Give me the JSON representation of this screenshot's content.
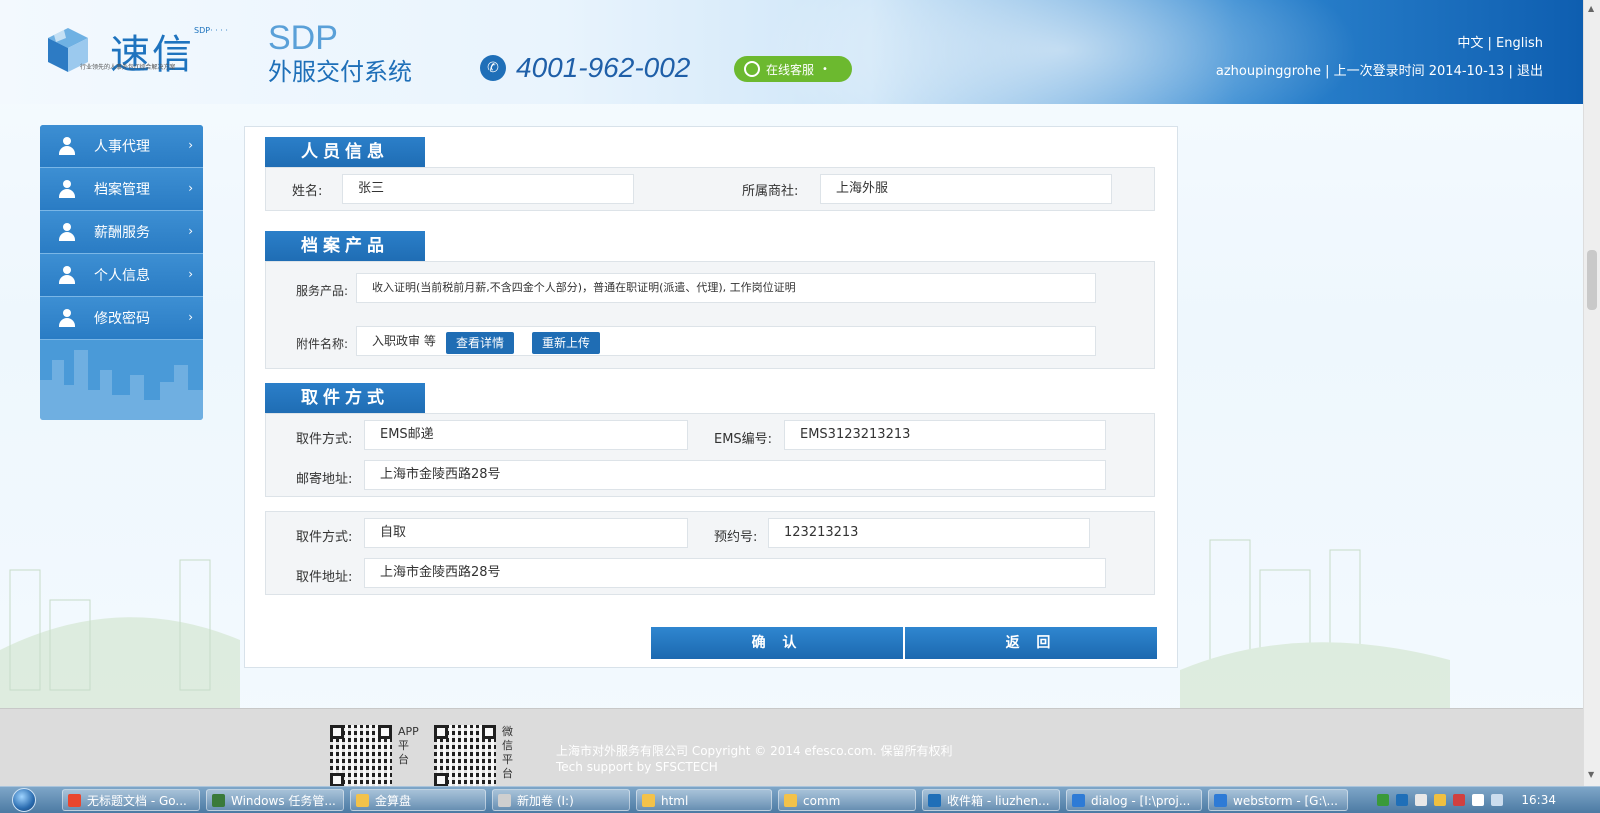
{
  "header": {
    "brand_cn": "速信",
    "brand_sdp": "SDP· · · ·",
    "brand_sub": "行业领先的人事外包IT综合解决方案",
    "brand_cube_text": "速立方",
    "sys_sdp": "SDP",
    "sys_name": "外服交付系统",
    "phone": "4001-962-002",
    "online_service": "在线客服",
    "lang_cn": "中文",
    "lang_sep": " | ",
    "lang_en": "English",
    "username": "azhoupinggrohe",
    "last_login_label": "上一次登录时间",
    "last_login_date": "2014-10-13",
    "logout": "退出"
  },
  "sidebar": {
    "items": [
      {
        "label": "人事代理"
      },
      {
        "label": "档案管理"
      },
      {
        "label": "薪酬服务"
      },
      {
        "label": "个人信息"
      },
      {
        "label": "修改密码"
      }
    ]
  },
  "person": {
    "title": "人员信息",
    "name_label": "姓名:",
    "name_value": "张三",
    "company_label": "所属商社:",
    "company_value": "上海外服"
  },
  "product": {
    "title": "档案产品",
    "service_label": "服务产品:",
    "service_value": "收入证明(当前税前月薪,不含四金个人部分)，普通在职证明(派遣、代理), 工作岗位证明",
    "attach_label": "附件名称:",
    "attach_value": "入职政审 等",
    "view_detail": "查看详情",
    "reupload": "重新上传"
  },
  "pickup": {
    "title": "取件方式",
    "a": {
      "method_label": "取件方式:",
      "method_value": "EMS邮递",
      "ems_label": "EMS编号:",
      "ems_value": "EMS3123213213",
      "addr_label": "邮寄地址:",
      "addr_value": "上海市金陵西路28号"
    },
    "b": {
      "method_label": "取件方式:",
      "method_value": "自取",
      "appt_label": "预约号:",
      "appt_value": "123213213",
      "addr_label": "取件地址:",
      "addr_value": "上海市金陵西路28号"
    }
  },
  "actions": {
    "confirm": "确 认",
    "back": "返 回"
  },
  "footer": {
    "qr1_label": "APP平台",
    "qr2_label": "微信平台",
    "copyright": "上海市对外服务有限公司 Copyright © 2014 efesco.com. 保留所有权利",
    "tech": "Tech support by SFSCTECH"
  },
  "taskbar": {
    "tasks": [
      {
        "label": "无标题文档 - Go...",
        "color": "#e9462e"
      },
      {
        "label": "Windows 任务管...",
        "color": "#3a7a3a"
      },
      {
        "label": "金算盘",
        "color": "#f3c24a"
      },
      {
        "label": "新加卷 (I:)",
        "color": "#cfcfcf"
      },
      {
        "label": "html",
        "color": "#f3c24a"
      },
      {
        "label": "comm",
        "color": "#f3c24a"
      },
      {
        "label": "收件箱 - liuzhen...",
        "color": "#1f6fb8"
      },
      {
        "label": "dialog - [I:\\proj...",
        "color": "#2e7bd6"
      },
      {
        "label": "webstorm - [G:\\...",
        "color": "#2e7bd6"
      }
    ],
    "clock": "16:34"
  },
  "colors": {
    "accent": "#1f6db4",
    "online_green": "#6cb92f",
    "sidebar_bg": "#2a7cc4"
  }
}
